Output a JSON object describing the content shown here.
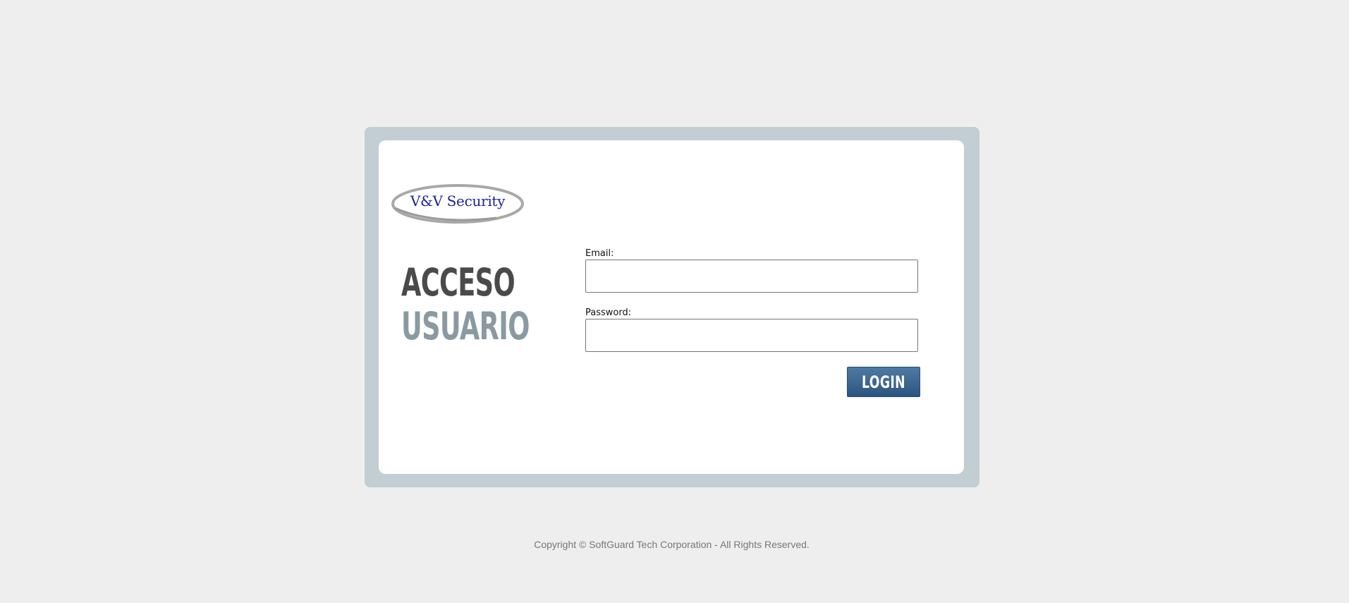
{
  "logo": {
    "text": "V&V Security"
  },
  "heading": {
    "line1": "ACCESO",
    "line2": "USUARIO"
  },
  "form": {
    "email_label": "Email:",
    "email_value": "",
    "password_label": "Password:",
    "password_value": "",
    "login_label": "LOGIN"
  },
  "footer": {
    "copyright": "Copyright © SoftGuard Tech Corporation - All Rights Reserved."
  },
  "colors": {
    "background": "#eeeeee",
    "frame": "#c3cdd4",
    "card": "#ffffff",
    "logo_text": "#22229a",
    "heading_dark": "#4a4a4a",
    "heading_light": "#8a9aa2",
    "button": "#2c5580"
  }
}
